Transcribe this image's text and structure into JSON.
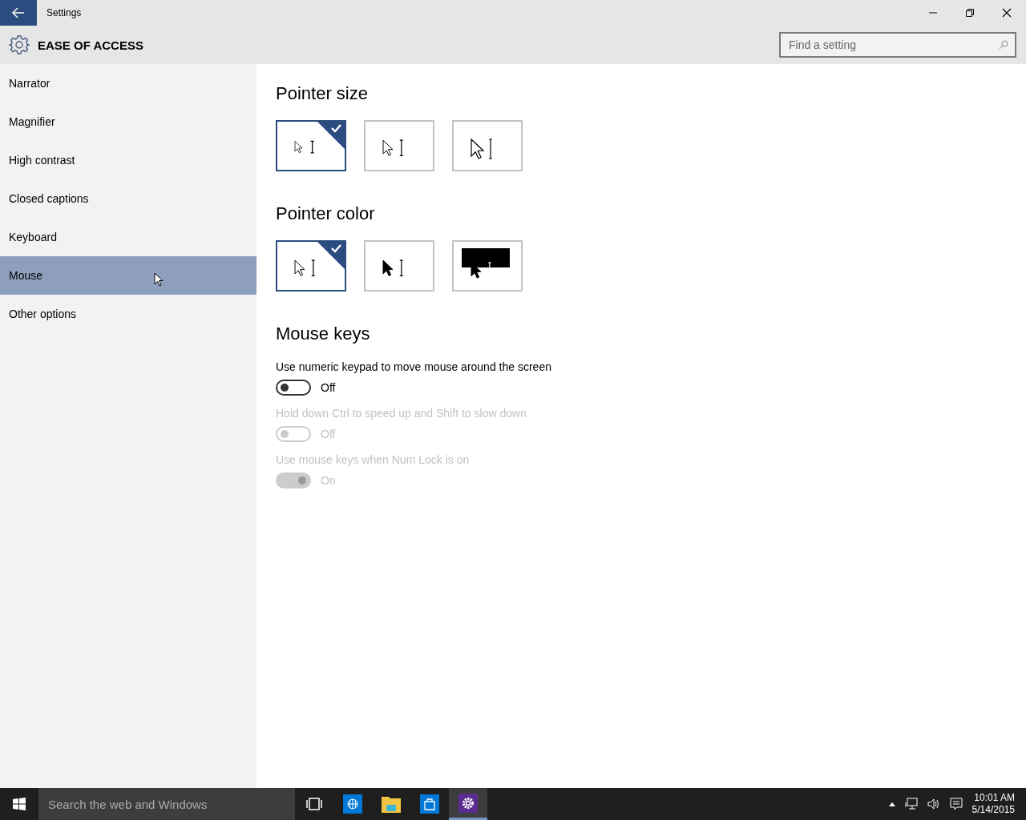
{
  "window": {
    "title": "Settings"
  },
  "header": {
    "title": "EASE OF ACCESS"
  },
  "search": {
    "placeholder": "Find a setting"
  },
  "sidebar": {
    "items": [
      {
        "label": "Narrator",
        "selected": false
      },
      {
        "label": "Magnifier",
        "selected": false
      },
      {
        "label": "High contrast",
        "selected": false
      },
      {
        "label": "Closed captions",
        "selected": false
      },
      {
        "label": "Keyboard",
        "selected": false
      },
      {
        "label": "Mouse",
        "selected": true
      },
      {
        "label": "Other options",
        "selected": false
      }
    ]
  },
  "pointer_size": {
    "title": "Pointer size",
    "options": [
      {
        "kind": "small",
        "selected": true
      },
      {
        "kind": "medium",
        "selected": false
      },
      {
        "kind": "large",
        "selected": false
      }
    ]
  },
  "pointer_color": {
    "title": "Pointer color",
    "options": [
      {
        "kind": "white",
        "selected": true
      },
      {
        "kind": "black",
        "selected": false
      },
      {
        "kind": "inverted",
        "selected": false
      }
    ]
  },
  "mouse_keys": {
    "title": "Mouse keys",
    "settings": [
      {
        "label": "Use numeric keypad to move mouse around the screen",
        "on": false,
        "disabled": false,
        "state": "Off"
      },
      {
        "label": "Hold down Ctrl to speed up and Shift to slow down",
        "on": false,
        "disabled": true,
        "state": "Off"
      },
      {
        "label": "Use mouse keys when Num Lock is on",
        "on": true,
        "disabled": true,
        "state": "On"
      }
    ]
  },
  "taskbar": {
    "search_placeholder": "Search the web and Windows",
    "apps": [
      {
        "kind": "task-view",
        "selected": false
      },
      {
        "kind": "browser",
        "selected": false
      },
      {
        "kind": "explorer",
        "selected": false
      },
      {
        "kind": "store",
        "selected": false
      },
      {
        "kind": "settings",
        "selected": true
      }
    ],
    "time": "10:01 AM",
    "date": "5/14/2015"
  }
}
